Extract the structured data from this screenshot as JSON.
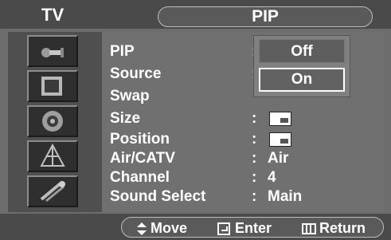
{
  "header": {
    "section": "TV",
    "title": "PIP"
  },
  "sidebar": {
    "items": [
      {
        "icon": "plug-icon"
      },
      {
        "icon": "picture-icon"
      },
      {
        "icon": "speaker-icon"
      },
      {
        "icon": "antenna-icon"
      },
      {
        "icon": "tools-icon"
      }
    ]
  },
  "menu": {
    "rows": [
      {
        "label": "PIP",
        "colon": ":",
        "value": ""
      },
      {
        "label": "Source",
        "colon": ":",
        "value": ""
      },
      {
        "label": "Swap",
        "colon": "",
        "value": ""
      },
      {
        "label": "Size",
        "colon": ":",
        "value": ""
      },
      {
        "label": "Position",
        "colon": ":",
        "value": ""
      },
      {
        "label": "Air/CATV",
        "colon": ":",
        "value": "Air"
      },
      {
        "label": "Channel",
        "colon": ":",
        "value": "4"
      },
      {
        "label": "Sound Select",
        "colon": ":",
        "value": "Main"
      }
    ]
  },
  "dropdown": {
    "options": [
      "Off",
      "On"
    ],
    "highlighted": "On"
  },
  "footer": {
    "move": "Move",
    "enter": "Enter",
    "return": "Return"
  },
  "colors": {
    "background": "#6d6d6d",
    "header": "#4a4a4a",
    "text": "#ffffff"
  }
}
